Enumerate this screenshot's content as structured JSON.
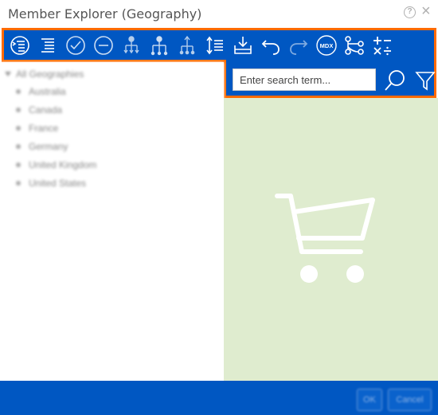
{
  "window": {
    "title": "Member Explorer (Geography)",
    "help_glyph": "?",
    "close_glyph": "×"
  },
  "toolbar": {
    "buttons": [
      {
        "name": "expand-all-icon"
      },
      {
        "name": "collapse-all-icon"
      },
      {
        "name": "select-all-icon"
      },
      {
        "name": "deselect-all-icon"
      },
      {
        "name": "select-children-icon"
      },
      {
        "name": "select-descendants-icon"
      },
      {
        "name": "select-parent-icon"
      },
      {
        "name": "sort-icon"
      },
      {
        "name": "import-icon"
      },
      {
        "name": "undo-icon"
      },
      {
        "name": "redo-icon"
      },
      {
        "name": "mdx-icon",
        "label": "MDX"
      },
      {
        "name": "hierarchy-icon"
      },
      {
        "name": "calculator-icon"
      }
    ]
  },
  "search": {
    "placeholder": "Enter search term..."
  },
  "tree": {
    "root": "All Geographies",
    "items": [
      "Australia",
      "Canada",
      "France",
      "Germany",
      "United Kingdom",
      "United States"
    ]
  },
  "footer": {
    "ok_label": "OK",
    "cancel_label": "Cancel"
  },
  "colors": {
    "toolbar": "#0057c2",
    "highlight": "#ff6b00",
    "preview_background": "#dfeccf"
  }
}
